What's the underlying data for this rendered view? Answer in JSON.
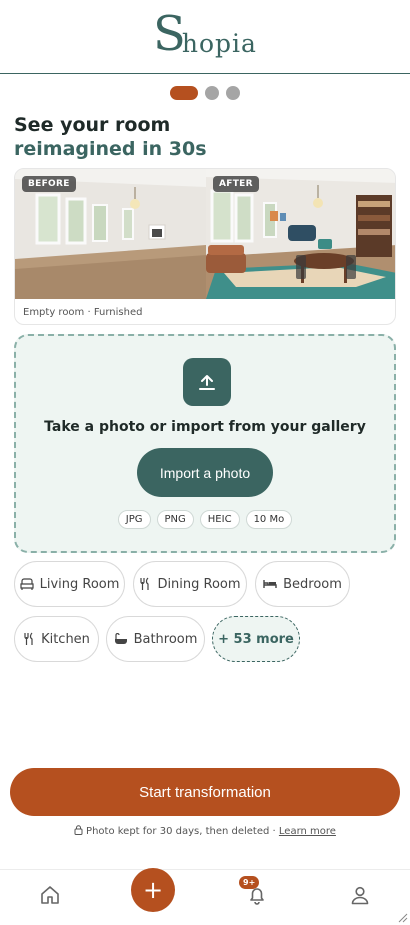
{
  "brand": {
    "name_initial": "S",
    "name_rest": "hopia"
  },
  "carousel": {
    "total": 3,
    "active": 0
  },
  "hero": {
    "line1": "See your room",
    "line2": "reimagined in 30s"
  },
  "compare": {
    "before_label": "BEFORE",
    "after_label": "AFTER",
    "caption": "Empty room · Furnished"
  },
  "upload": {
    "title": "Take a photo or import from your gallery",
    "button": "Import a photo",
    "formats": [
      "JPG",
      "PNG",
      "HEIC",
      "10 Mo"
    ]
  },
  "rooms": {
    "items": [
      {
        "label": "Living Room",
        "icon": "sofa-icon"
      },
      {
        "label": "Dining Room",
        "icon": "cutlery-icon"
      },
      {
        "label": "Bedroom",
        "icon": "bed-icon"
      },
      {
        "label": "Kitchen",
        "icon": "cutlery-icon"
      },
      {
        "label": "Bathroom",
        "icon": "bathtub-icon"
      }
    ],
    "more": "+ 53 more"
  },
  "cta": {
    "label": "Start transformation"
  },
  "privacy": {
    "text": "Photo kept for 30 days, then deleted · ",
    "link": "Learn more"
  },
  "tabbar": {
    "badge": "9+",
    "fab": "+"
  },
  "colors": {
    "primary": "#3b6561",
    "accent": "#b5501f",
    "tint": "#eef5f2"
  }
}
